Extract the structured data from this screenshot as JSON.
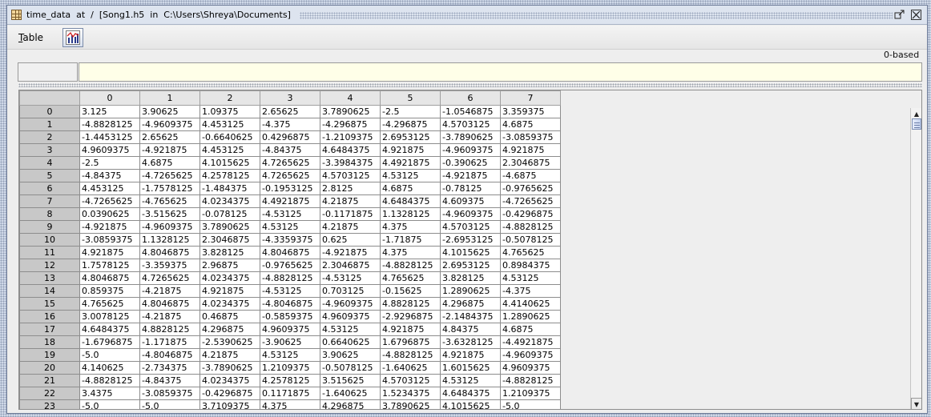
{
  "window": {
    "title": "time_data  at  /  [Song1.h5  in  C:\\Users\\Shreya\\Documents]",
    "restore_icon": "restore-icon",
    "close_icon": "close-icon"
  },
  "menubar": {
    "table_menu": "Table",
    "chart_button_icon": "line-chart-icon"
  },
  "index_mode": "0-based",
  "cell_editor": {
    "cell_ref": "",
    "value": ""
  },
  "table": {
    "columns": [
      "0",
      "1",
      "2",
      "3",
      "4",
      "5",
      "6",
      "7"
    ],
    "rows": [
      {
        "index": "0",
        "values": [
          "3.125",
          "3.90625",
          "1.09375",
          "2.65625",
          "3.7890625",
          "-2.5",
          "-1.0546875",
          "3.359375"
        ]
      },
      {
        "index": "1",
        "values": [
          "-4.8828125",
          "-4.9609375",
          "4.453125",
          "-4.375",
          "-4.296875",
          "-4.296875",
          "4.5703125",
          "4.6875"
        ]
      },
      {
        "index": "2",
        "values": [
          "-1.4453125",
          "2.65625",
          "-0.6640625",
          "0.4296875",
          "-1.2109375",
          "2.6953125",
          "-3.7890625",
          "-3.0859375"
        ]
      },
      {
        "index": "3",
        "values": [
          "4.9609375",
          "-4.921875",
          "4.453125",
          "-4.84375",
          "4.6484375",
          "4.921875",
          "-4.9609375",
          "4.921875"
        ]
      },
      {
        "index": "4",
        "values": [
          "-2.5",
          "4.6875",
          "4.1015625",
          "4.7265625",
          "-3.3984375",
          "4.4921875",
          "-0.390625",
          "2.3046875"
        ]
      },
      {
        "index": "5",
        "values": [
          "-4.84375",
          "-4.7265625",
          "4.2578125",
          "4.7265625",
          "4.5703125",
          "4.53125",
          "-4.921875",
          "-4.6875"
        ]
      },
      {
        "index": "6",
        "values": [
          "4.453125",
          "-1.7578125",
          "-1.484375",
          "-0.1953125",
          "2.8125",
          "4.6875",
          "-0.78125",
          "-0.9765625"
        ]
      },
      {
        "index": "7",
        "values": [
          "-4.7265625",
          "-4.765625",
          "4.0234375",
          "4.4921875",
          "4.21875",
          "4.6484375",
          "4.609375",
          "-4.7265625"
        ]
      },
      {
        "index": "8",
        "values": [
          "0.0390625",
          "-3.515625",
          "-0.078125",
          "-4.53125",
          "-0.1171875",
          "1.1328125",
          "-4.9609375",
          "-0.4296875"
        ]
      },
      {
        "index": "9",
        "values": [
          "-4.921875",
          "-4.9609375",
          "3.7890625",
          "4.53125",
          "4.21875",
          "4.375",
          "4.5703125",
          "-4.8828125"
        ]
      },
      {
        "index": "10",
        "values": [
          "-3.0859375",
          "1.1328125",
          "2.3046875",
          "-4.3359375",
          "0.625",
          "-1.71875",
          "-2.6953125",
          "-0.5078125"
        ]
      },
      {
        "index": "11",
        "values": [
          "4.921875",
          "4.8046875",
          "3.828125",
          "4.8046875",
          "-4.921875",
          "4.375",
          "4.1015625",
          "4.765625"
        ]
      },
      {
        "index": "12",
        "values": [
          "1.7578125",
          "-3.359375",
          "2.96875",
          "-0.9765625",
          "2.3046875",
          "-4.8828125",
          "2.6953125",
          "0.8984375"
        ]
      },
      {
        "index": "13",
        "values": [
          "4.8046875",
          "4.7265625",
          "4.0234375",
          "-4.8828125",
          "-4.53125",
          "4.765625",
          "3.828125",
          "4.53125"
        ]
      },
      {
        "index": "14",
        "values": [
          "0.859375",
          "-4.21875",
          "4.921875",
          "-4.53125",
          "0.703125",
          "-0.15625",
          "1.2890625",
          "-4.375"
        ]
      },
      {
        "index": "15",
        "values": [
          "4.765625",
          "4.8046875",
          "4.0234375",
          "-4.8046875",
          "-4.9609375",
          "4.8828125",
          "4.296875",
          "4.4140625"
        ]
      },
      {
        "index": "16",
        "values": [
          "3.0078125",
          "-4.21875",
          "0.46875",
          "-0.5859375",
          "4.9609375",
          "-2.9296875",
          "-2.1484375",
          "1.2890625"
        ]
      },
      {
        "index": "17",
        "values": [
          "4.6484375",
          "4.8828125",
          "4.296875",
          "4.9609375",
          "4.53125",
          "4.921875",
          "4.84375",
          "4.6875"
        ]
      },
      {
        "index": "18",
        "values": [
          "-1.6796875",
          "-1.171875",
          "-2.5390625",
          "-3.90625",
          "0.6640625",
          "1.6796875",
          "-3.6328125",
          "-4.4921875"
        ]
      },
      {
        "index": "19",
        "values": [
          "-5.0",
          "-4.8046875",
          "4.21875",
          "4.53125",
          "3.90625",
          "-4.8828125",
          "4.921875",
          "-4.9609375"
        ]
      },
      {
        "index": "20",
        "values": [
          "4.140625",
          "-2.734375",
          "-3.7890625",
          "1.2109375",
          "-0.5078125",
          "-1.640625",
          "1.6015625",
          "4.9609375"
        ]
      },
      {
        "index": "21",
        "values": [
          "-4.8828125",
          "-4.84375",
          "4.0234375",
          "4.2578125",
          "3.515625",
          "4.5703125",
          "4.53125",
          "-4.8828125"
        ]
      },
      {
        "index": "22",
        "values": [
          "3.4375",
          "-3.0859375",
          "-0.4296875",
          "0.1171875",
          "-1.640625",
          "1.5234375",
          "4.6484375",
          "1.2109375"
        ]
      },
      {
        "index": "23",
        "values": [
          "-5.0",
          "-5.0",
          "3.7109375",
          "4.375",
          "4.296875",
          "3.7890625",
          "4.1015625",
          "-5.0"
        ]
      }
    ]
  },
  "scrollbar": {
    "up_icon": "scroll-up-arrow-icon",
    "down_icon": "scroll-down-arrow-icon"
  }
}
